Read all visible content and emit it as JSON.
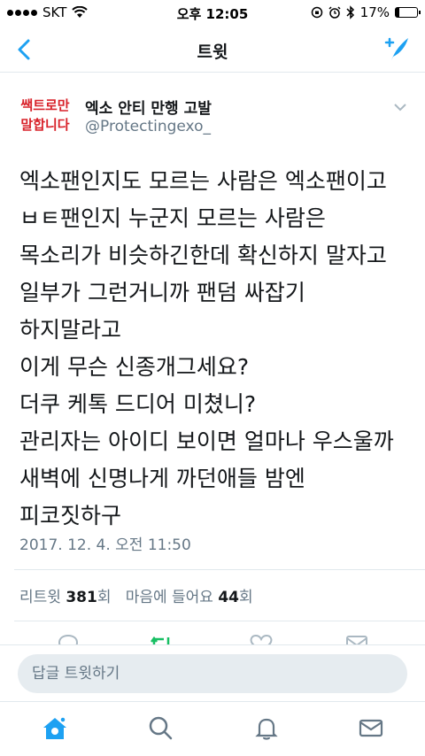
{
  "status_bar": {
    "carrier": "SKT",
    "time": "오후 12:05",
    "battery": "17%",
    "battery_level": 0.17
  },
  "nav": {
    "title": "트윗"
  },
  "tweet": {
    "avatar_text_line1": "쌕트로만",
    "avatar_text_line2": "말합니다",
    "display_name": "엑소 안티 만행 고발",
    "handle": "@Protectingexo_",
    "text_lines": [
      "엑소팬인지도 모르는 사람은 엑소팬이고",
      "ㅂㅌ팬인지 누군지 모르는 사람은",
      "목소리가 비슷하긴한데 확신하지 말자고",
      "일부가 그런거니까 팬덤 싸잡기",
      "하지말라고",
      "이게 무슨 신종개그세요?",
      "더쿠 케톡 드디어 미쳤니?",
      "관리자는 아이디 보이면 얼마나 우스울까",
      "새벽에 신명나게 까던애들 밤엔",
      "피코짓하구"
    ],
    "timestamp": "2017. 12. 4. 오전 11:50",
    "retweet_label": "리트윗",
    "retweet_count": "381",
    "retweet_unit": "회",
    "like_label": "마음에 들어요",
    "like_count": "44",
    "like_unit": "회"
  },
  "reply": {
    "placeholder": "답글 트윗하기"
  },
  "colors": {
    "accent": "#1da1f2",
    "avatar_red": "#d8222a",
    "muted": "#657786",
    "retweet_green": "#17bf63"
  }
}
